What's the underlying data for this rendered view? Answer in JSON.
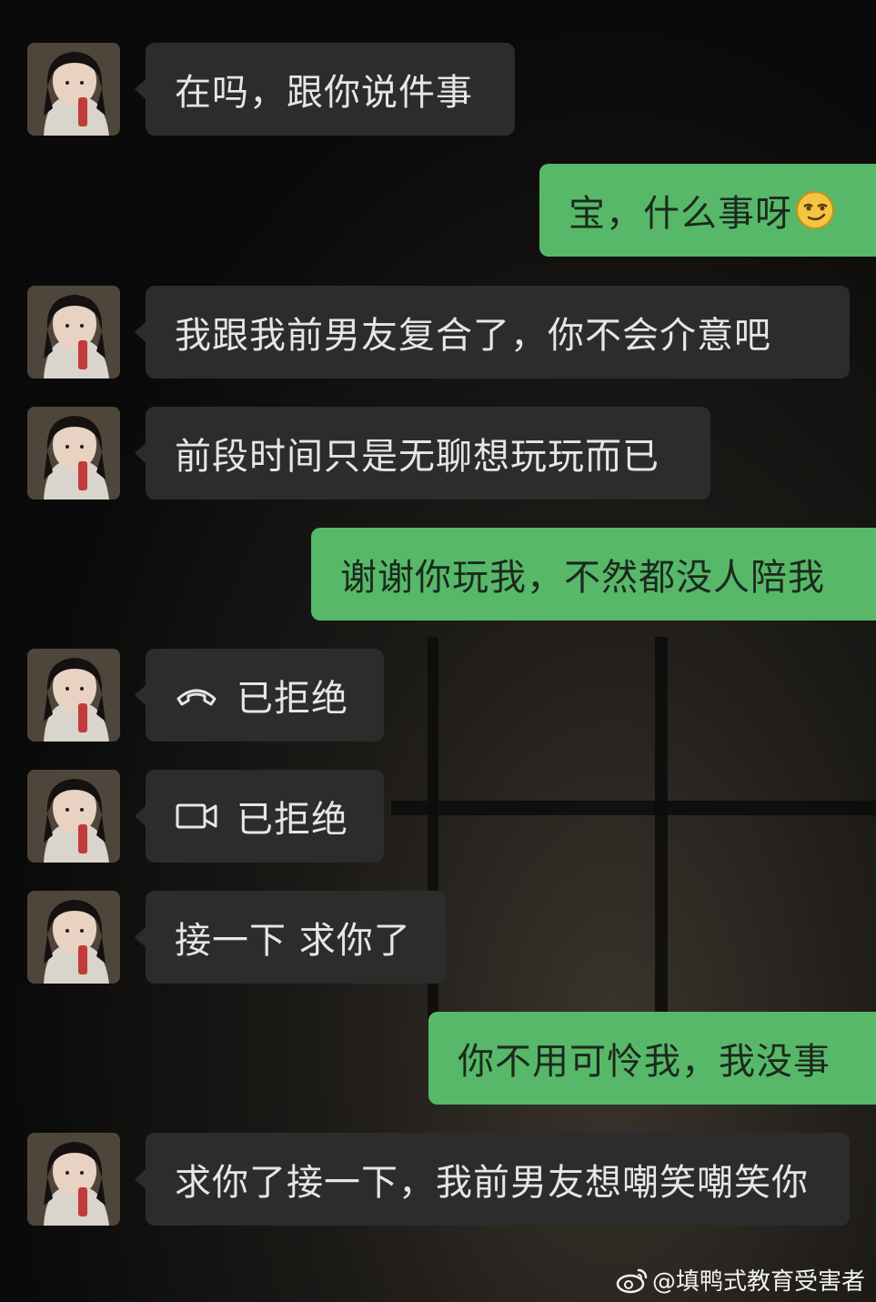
{
  "messages": [
    {
      "side": "in",
      "text": "在吗，跟你说件事"
    },
    {
      "side": "out",
      "text": "宝，什么事呀",
      "emoji": "smirk-emoji"
    },
    {
      "side": "in",
      "text": "我跟我前男友复合了，你不会介意吧"
    },
    {
      "side": "in",
      "text": "前段时间只是无聊想玩玩而已"
    },
    {
      "side": "out",
      "text": "谢谢你玩我，不然都没人陪我"
    },
    {
      "side": "in",
      "icon": "phone-hangup-icon",
      "text": "已拒绝"
    },
    {
      "side": "in",
      "icon": "video-call-icon",
      "text": "已拒绝"
    },
    {
      "side": "in",
      "text": "接一下 求你了"
    },
    {
      "side": "out",
      "text": "你不用可怜我，我没事"
    },
    {
      "side": "in",
      "text": "求你了接一下，我前男友想嘲笑嘲笑你"
    }
  ],
  "watermark": {
    "icon": "weibo-icon",
    "text": "@填鸭式教育受害者"
  },
  "colors": {
    "incoming_bubble": "#2c2c2c",
    "outgoing_bubble": "#58b86a",
    "background": "#0a0a0a"
  }
}
